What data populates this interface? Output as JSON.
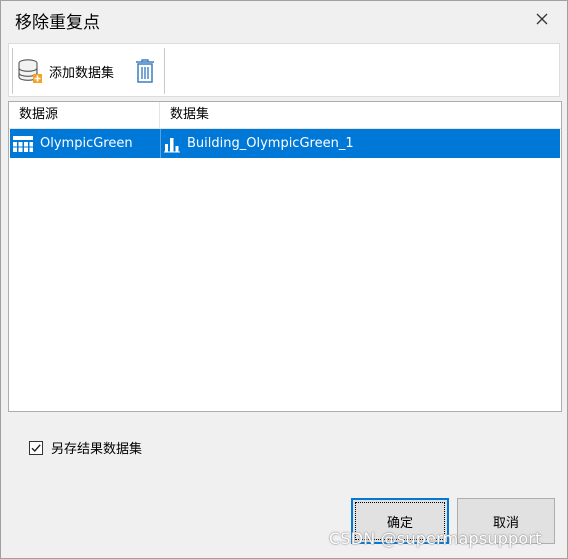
{
  "dialog": {
    "title": "移除重复点"
  },
  "toolbar": {
    "add_label": "添加数据集"
  },
  "table": {
    "columns": [
      "数据源",
      "数据集"
    ],
    "rows": [
      {
        "datasource": "OlympicGreen",
        "dataset": "Building_OlympicGreen_1",
        "selected": true
      }
    ]
  },
  "options": {
    "save_result_label": "另存结果数据集",
    "save_result_checked": true
  },
  "buttons": {
    "ok": "确定",
    "cancel": "取消"
  },
  "watermark": "CSDN @supermapsupport",
  "colors": {
    "selection": "#0078d7",
    "accent_orange": "#f4a127",
    "icon_blue": "#3d7fc4"
  }
}
